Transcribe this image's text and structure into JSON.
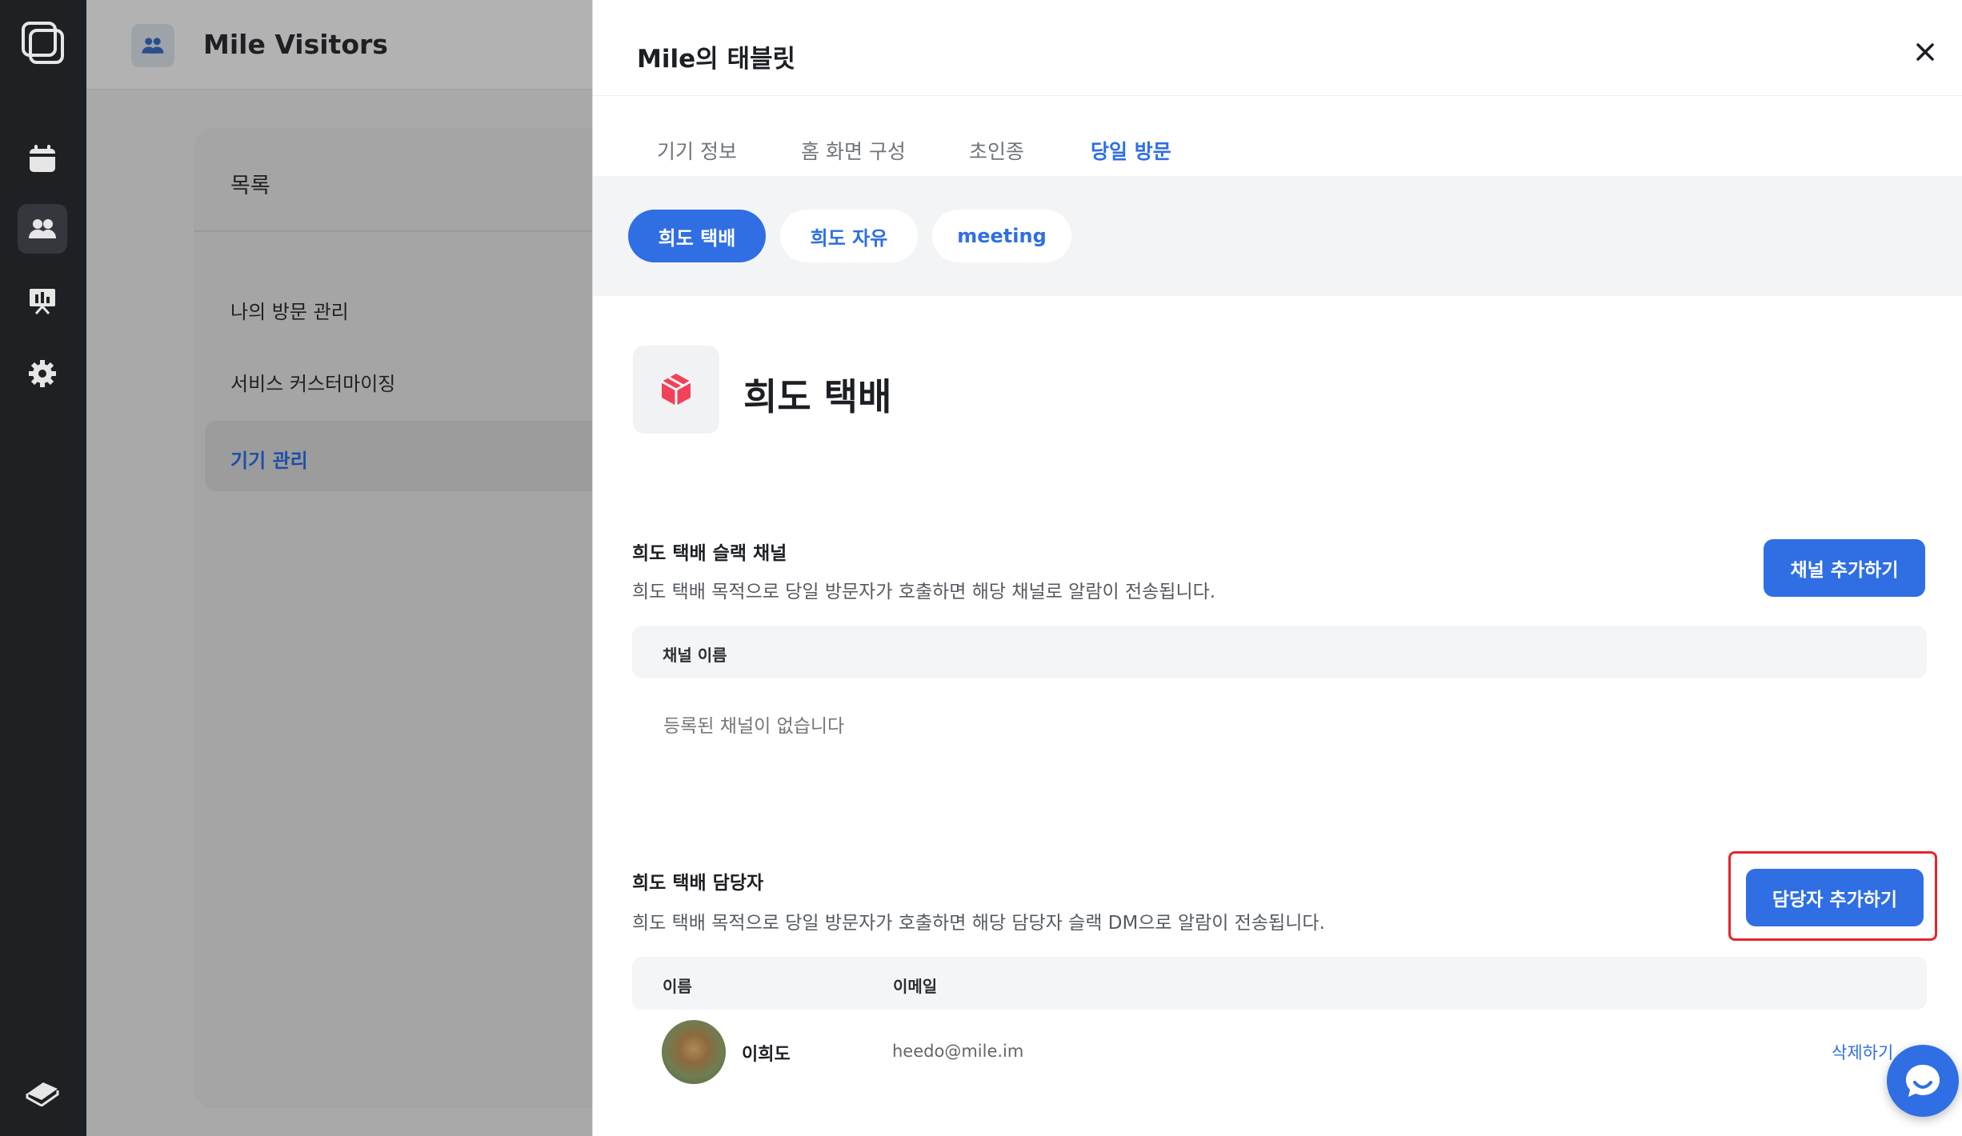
{
  "workspace": {
    "app_title": "Mile Visitors"
  },
  "sidebar": {
    "title": "목록",
    "items": [
      {
        "label": "나의 방문 관리",
        "chevron": "›"
      },
      {
        "label": "서비스 커스터마이징",
        "chevron": "›"
      },
      {
        "label": "기기 관리",
        "chevron": "›",
        "active": true
      }
    ]
  },
  "modal": {
    "title": "Mile의 태블릿",
    "tabs": [
      "기기 정보",
      "홈 화면 구성",
      "초인종",
      "당일 방문"
    ],
    "active_tab": "당일 방문",
    "purpose_pills": [
      "희도 택배",
      "희도 자유",
      "meeting"
    ],
    "selected_purpose": "희도 택배",
    "purpose_heading": "희도 택배",
    "channel_section": {
      "title": "희도 택배 슬랙 채널",
      "description": "희도 택배 목적으로 당일 방문자가 호출하면 해당 채널로 알람이 전송됩니다.",
      "add_button": "채널 추가하기",
      "column": "채널 이름",
      "empty_text": "등록된 채널이 없습니다"
    },
    "manager_section": {
      "title": "희도 택배 담당자",
      "description": "희도 택배 목적으로 당일 방문자가 호출하면 해당 담당자 슬랙 DM으로 알람이 전송됩니다.",
      "add_button": "담당자 추가하기",
      "columns": [
        "이름",
        "이메일"
      ],
      "rows": [
        {
          "name": "이희도",
          "email": "heedo@mile.im",
          "action": "삭제하기"
        }
      ]
    }
  },
  "colors": {
    "accent": "#2f6fe3",
    "highlight": "#e8242a",
    "rail": "#1e2124"
  },
  "icons": [
    "app-logo-icon",
    "calendar-icon",
    "users-icon",
    "presentation-icon",
    "gear-icon",
    "book-icon",
    "close-icon",
    "package-icon",
    "chat-icon"
  ]
}
